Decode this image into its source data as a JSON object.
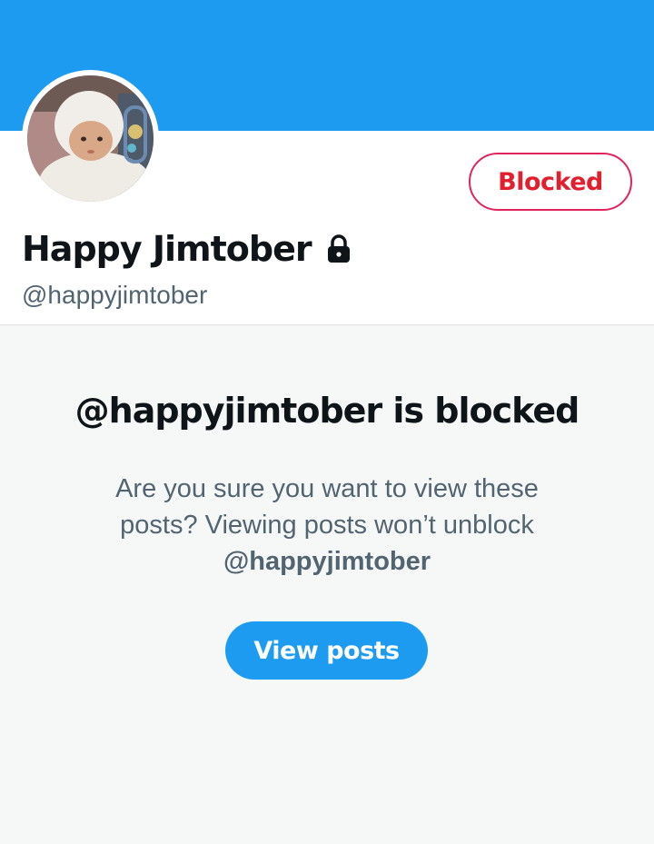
{
  "colors": {
    "banner": "#1d9bf0",
    "blocked_red": "#e0245e",
    "blocked_text": "#e0202e",
    "panel_bg": "#f6f8f8",
    "primary_button": "#1d9bf0"
  },
  "profile": {
    "display_name": "Happy Jimtober",
    "handle": "@happyjimtober",
    "protected_icon": "lock-icon",
    "blocked_button_label": "Blocked"
  },
  "blocked_notice": {
    "title": "@happyjimtober is blocked",
    "message": "Are you sure you want to view these posts? Viewing posts won’t unblock",
    "handle": "@happyjimtober",
    "view_button_label": "View posts"
  }
}
